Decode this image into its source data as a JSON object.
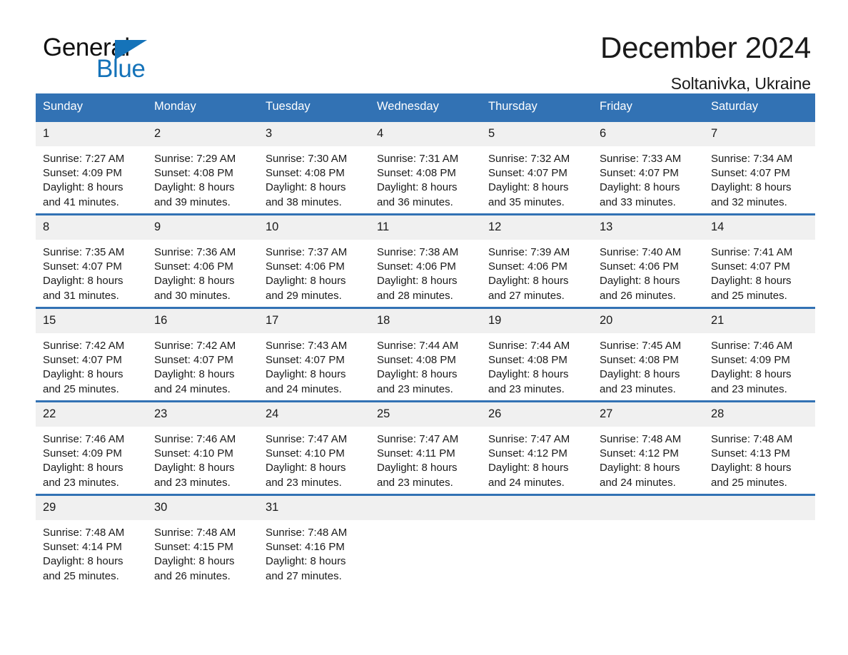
{
  "brand": {
    "name_dark": "General",
    "name_blue": "Blue",
    "triangle_icon": "triangle-icon",
    "accent_color": "#1573b9"
  },
  "header": {
    "title": "December 2024",
    "subtitle": "Soltanivka, Ukraine"
  },
  "calendar": {
    "header_bg": "#3272b4",
    "daynum_bg": "#f0f0f0",
    "weekday_headers": [
      "Sunday",
      "Monday",
      "Tuesday",
      "Wednesday",
      "Thursday",
      "Friday",
      "Saturday"
    ],
    "weeks": [
      [
        {
          "day": "1",
          "sunrise": "Sunrise: 7:27 AM",
          "sunset": "Sunset: 4:09 PM",
          "daylight_1": "Daylight: 8 hours",
          "daylight_2": "and 41 minutes."
        },
        {
          "day": "2",
          "sunrise": "Sunrise: 7:29 AM",
          "sunset": "Sunset: 4:08 PM",
          "daylight_1": "Daylight: 8 hours",
          "daylight_2": "and 39 minutes."
        },
        {
          "day": "3",
          "sunrise": "Sunrise: 7:30 AM",
          "sunset": "Sunset: 4:08 PM",
          "daylight_1": "Daylight: 8 hours",
          "daylight_2": "and 38 minutes."
        },
        {
          "day": "4",
          "sunrise": "Sunrise: 7:31 AM",
          "sunset": "Sunset: 4:08 PM",
          "daylight_1": "Daylight: 8 hours",
          "daylight_2": "and 36 minutes."
        },
        {
          "day": "5",
          "sunrise": "Sunrise: 7:32 AM",
          "sunset": "Sunset: 4:07 PM",
          "daylight_1": "Daylight: 8 hours",
          "daylight_2": "and 35 minutes."
        },
        {
          "day": "6",
          "sunrise": "Sunrise: 7:33 AM",
          "sunset": "Sunset: 4:07 PM",
          "daylight_1": "Daylight: 8 hours",
          "daylight_2": "and 33 minutes."
        },
        {
          "day": "7",
          "sunrise": "Sunrise: 7:34 AM",
          "sunset": "Sunset: 4:07 PM",
          "daylight_1": "Daylight: 8 hours",
          "daylight_2": "and 32 minutes."
        }
      ],
      [
        {
          "day": "8",
          "sunrise": "Sunrise: 7:35 AM",
          "sunset": "Sunset: 4:07 PM",
          "daylight_1": "Daylight: 8 hours",
          "daylight_2": "and 31 minutes."
        },
        {
          "day": "9",
          "sunrise": "Sunrise: 7:36 AM",
          "sunset": "Sunset: 4:06 PM",
          "daylight_1": "Daylight: 8 hours",
          "daylight_2": "and 30 minutes."
        },
        {
          "day": "10",
          "sunrise": "Sunrise: 7:37 AM",
          "sunset": "Sunset: 4:06 PM",
          "daylight_1": "Daylight: 8 hours",
          "daylight_2": "and 29 minutes."
        },
        {
          "day": "11",
          "sunrise": "Sunrise: 7:38 AM",
          "sunset": "Sunset: 4:06 PM",
          "daylight_1": "Daylight: 8 hours",
          "daylight_2": "and 28 minutes."
        },
        {
          "day": "12",
          "sunrise": "Sunrise: 7:39 AM",
          "sunset": "Sunset: 4:06 PM",
          "daylight_1": "Daylight: 8 hours",
          "daylight_2": "and 27 minutes."
        },
        {
          "day": "13",
          "sunrise": "Sunrise: 7:40 AM",
          "sunset": "Sunset: 4:06 PM",
          "daylight_1": "Daylight: 8 hours",
          "daylight_2": "and 26 minutes."
        },
        {
          "day": "14",
          "sunrise": "Sunrise: 7:41 AM",
          "sunset": "Sunset: 4:07 PM",
          "daylight_1": "Daylight: 8 hours",
          "daylight_2": "and 25 minutes."
        }
      ],
      [
        {
          "day": "15",
          "sunrise": "Sunrise: 7:42 AM",
          "sunset": "Sunset: 4:07 PM",
          "daylight_1": "Daylight: 8 hours",
          "daylight_2": "and 25 minutes."
        },
        {
          "day": "16",
          "sunrise": "Sunrise: 7:42 AM",
          "sunset": "Sunset: 4:07 PM",
          "daylight_1": "Daylight: 8 hours",
          "daylight_2": "and 24 minutes."
        },
        {
          "day": "17",
          "sunrise": "Sunrise: 7:43 AM",
          "sunset": "Sunset: 4:07 PM",
          "daylight_1": "Daylight: 8 hours",
          "daylight_2": "and 24 minutes."
        },
        {
          "day": "18",
          "sunrise": "Sunrise: 7:44 AM",
          "sunset": "Sunset: 4:08 PM",
          "daylight_1": "Daylight: 8 hours",
          "daylight_2": "and 23 minutes."
        },
        {
          "day": "19",
          "sunrise": "Sunrise: 7:44 AM",
          "sunset": "Sunset: 4:08 PM",
          "daylight_1": "Daylight: 8 hours",
          "daylight_2": "and 23 minutes."
        },
        {
          "day": "20",
          "sunrise": "Sunrise: 7:45 AM",
          "sunset": "Sunset: 4:08 PM",
          "daylight_1": "Daylight: 8 hours",
          "daylight_2": "and 23 minutes."
        },
        {
          "day": "21",
          "sunrise": "Sunrise: 7:46 AM",
          "sunset": "Sunset: 4:09 PM",
          "daylight_1": "Daylight: 8 hours",
          "daylight_2": "and 23 minutes."
        }
      ],
      [
        {
          "day": "22",
          "sunrise": "Sunrise: 7:46 AM",
          "sunset": "Sunset: 4:09 PM",
          "daylight_1": "Daylight: 8 hours",
          "daylight_2": "and 23 minutes."
        },
        {
          "day": "23",
          "sunrise": "Sunrise: 7:46 AM",
          "sunset": "Sunset: 4:10 PM",
          "daylight_1": "Daylight: 8 hours",
          "daylight_2": "and 23 minutes."
        },
        {
          "day": "24",
          "sunrise": "Sunrise: 7:47 AM",
          "sunset": "Sunset: 4:10 PM",
          "daylight_1": "Daylight: 8 hours",
          "daylight_2": "and 23 minutes."
        },
        {
          "day": "25",
          "sunrise": "Sunrise: 7:47 AM",
          "sunset": "Sunset: 4:11 PM",
          "daylight_1": "Daylight: 8 hours",
          "daylight_2": "and 23 minutes."
        },
        {
          "day": "26",
          "sunrise": "Sunrise: 7:47 AM",
          "sunset": "Sunset: 4:12 PM",
          "daylight_1": "Daylight: 8 hours",
          "daylight_2": "and 24 minutes."
        },
        {
          "day": "27",
          "sunrise": "Sunrise: 7:48 AM",
          "sunset": "Sunset: 4:12 PM",
          "daylight_1": "Daylight: 8 hours",
          "daylight_2": "and 24 minutes."
        },
        {
          "day": "28",
          "sunrise": "Sunrise: 7:48 AM",
          "sunset": "Sunset: 4:13 PM",
          "daylight_1": "Daylight: 8 hours",
          "daylight_2": "and 25 minutes."
        }
      ],
      [
        {
          "day": "29",
          "sunrise": "Sunrise: 7:48 AM",
          "sunset": "Sunset: 4:14 PM",
          "daylight_1": "Daylight: 8 hours",
          "daylight_2": "and 25 minutes."
        },
        {
          "day": "30",
          "sunrise": "Sunrise: 7:48 AM",
          "sunset": "Sunset: 4:15 PM",
          "daylight_1": "Daylight: 8 hours",
          "daylight_2": "and 26 minutes."
        },
        {
          "day": "31",
          "sunrise": "Sunrise: 7:48 AM",
          "sunset": "Sunset: 4:16 PM",
          "daylight_1": "Daylight: 8 hours",
          "daylight_2": "and 27 minutes."
        },
        {
          "day": "",
          "sunrise": "",
          "sunset": "",
          "daylight_1": "",
          "daylight_2": ""
        },
        {
          "day": "",
          "sunrise": "",
          "sunset": "",
          "daylight_1": "",
          "daylight_2": ""
        },
        {
          "day": "",
          "sunrise": "",
          "sunset": "",
          "daylight_1": "",
          "daylight_2": ""
        },
        {
          "day": "",
          "sunrise": "",
          "sunset": "",
          "daylight_1": "",
          "daylight_2": ""
        }
      ]
    ]
  }
}
